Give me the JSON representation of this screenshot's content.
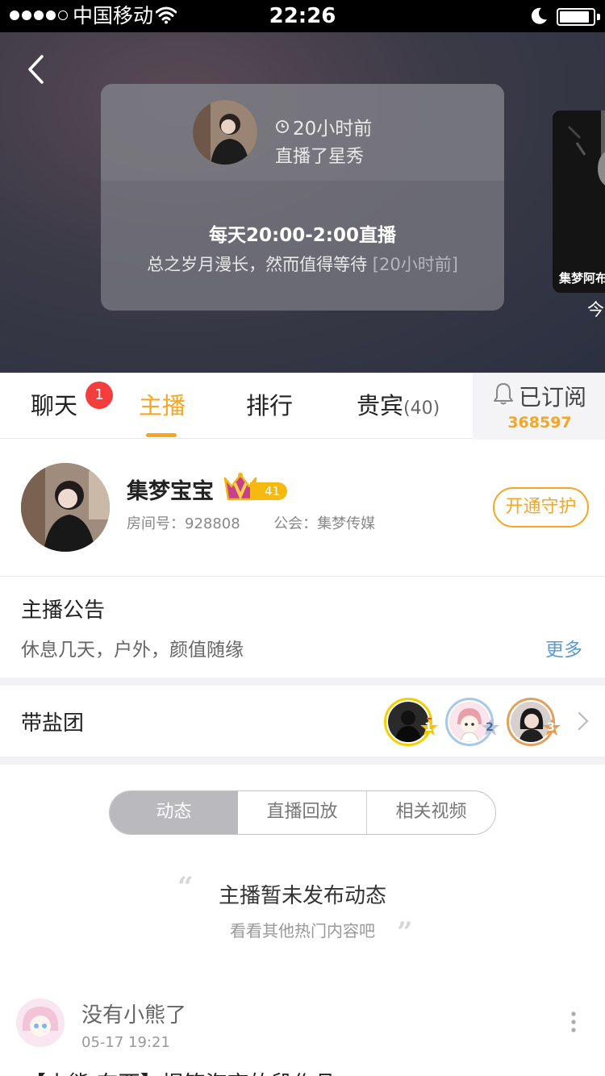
{
  "status_bar": {
    "carrier": "中国移动",
    "time": "22:26"
  },
  "live_card": {
    "time_ago": "20小时前",
    "action": "直播了星秀",
    "schedule": "每天20:00-2:00直播",
    "description": "总之岁月漫长，然而值得等待",
    "description_time": "[20小时前]"
  },
  "side_card": {
    "name": "集梦阿布",
    "caption": "今"
  },
  "tabs": {
    "chat": "聊天",
    "chat_badge": "1",
    "host": "主播",
    "rank": "排行",
    "guests": "贵宾",
    "guests_count": "(40)",
    "subscribe_label": "已订阅",
    "subscribe_count": "368597"
  },
  "host": {
    "name": "集梦宝宝",
    "level": "41",
    "room_label": "房间号：",
    "room_id": "928808",
    "guild_label": "公会：",
    "guild": "集梦传媒",
    "guard_button": "开通守护"
  },
  "notice": {
    "title": "主播公告",
    "text": "休息几天，户外，颜值随缘",
    "more": "更多"
  },
  "fans": {
    "title": "带盐团",
    "ranks": [
      "1",
      "2",
      "3"
    ]
  },
  "segment": {
    "items": [
      "动态",
      "直播回放",
      "相关视频"
    ]
  },
  "empty_state": {
    "title": "主播暂未发布动态",
    "subtitle": "看看其他热门内容吧"
  },
  "post": {
    "user": "没有小熊了",
    "time": "05-17 19:21",
    "body": "【小熊·东西】揭笛海夜的段作品"
  },
  "colors": {
    "accent": "#f5a623",
    "badge_red": "#f43e3e",
    "link_blue": "#5b9bd5"
  }
}
